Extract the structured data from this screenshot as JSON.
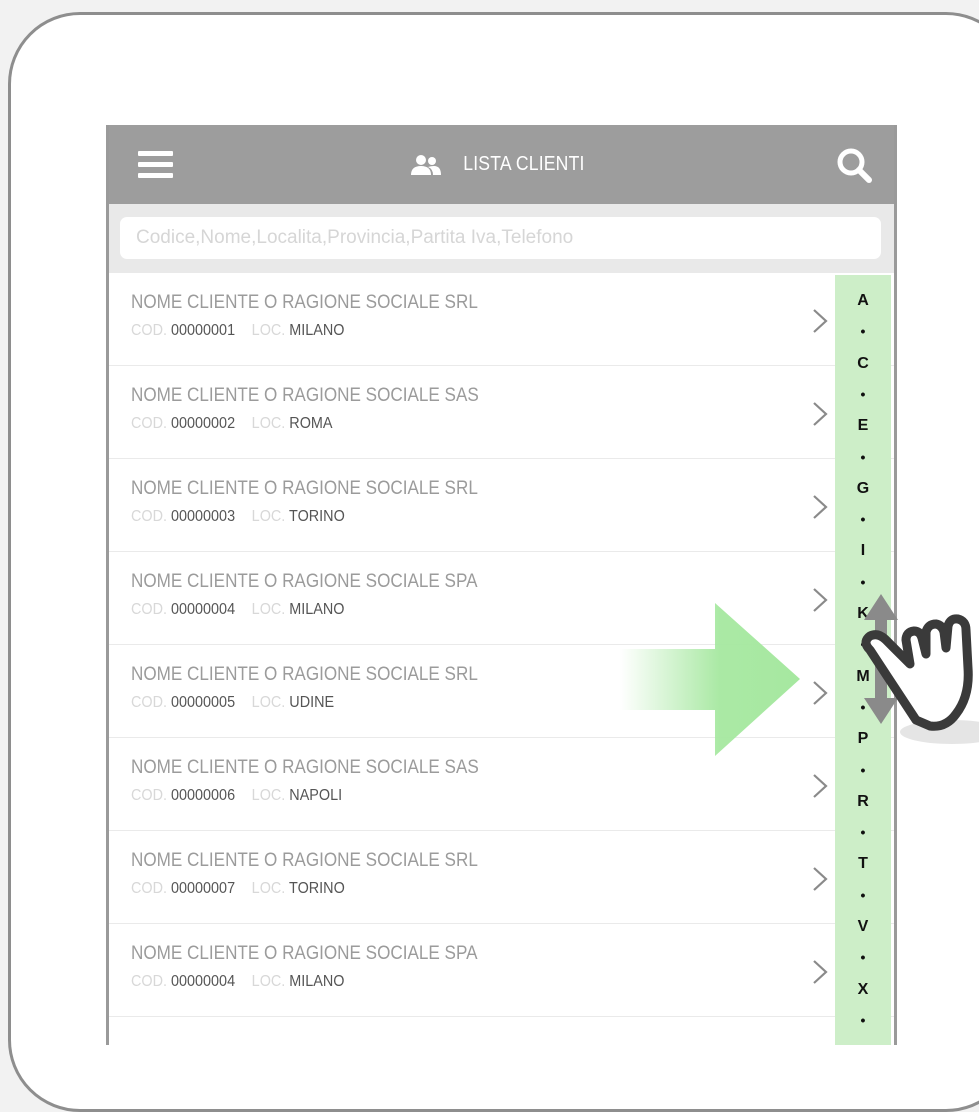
{
  "header": {
    "title": "LISTA CLIENTI",
    "menu_icon": "hamburger-menu-icon",
    "users_icon": "users-icon",
    "search_icon": "search-icon"
  },
  "search": {
    "placeholder": "Codice,Nome,Localita,Provincia,Partita Iva,Telefono"
  },
  "labels": {
    "cod": "COD.",
    "loc": "LOC."
  },
  "clients": [
    {
      "name": "NOME CLIENTE O RAGIONE SOCIALE SRL",
      "code": "00000001",
      "loc": "MILANO"
    },
    {
      "name": "NOME CLIENTE O RAGIONE SOCIALE SAS",
      "code": "00000002",
      "loc": "ROMA"
    },
    {
      "name": "NOME CLIENTE O RAGIONE SOCIALE SRL",
      "code": "00000003",
      "loc": "TORINO"
    },
    {
      "name": "NOME CLIENTE O RAGIONE SOCIALE SPA",
      "code": "00000004",
      "loc": "MILANO"
    },
    {
      "name": "NOME CLIENTE O RAGIONE SOCIALE SRL",
      "code": "00000005",
      "loc": "UDINE"
    },
    {
      "name": "NOME CLIENTE O RAGIONE SOCIALE SAS",
      "code": "00000006",
      "loc": "NAPOLI"
    },
    {
      "name": "NOME CLIENTE O RAGIONE SOCIALE SRL",
      "code": "00000007",
      "loc": "TORINO"
    },
    {
      "name": "NOME CLIENTE O RAGIONE SOCIALE SPA",
      "code": "00000004",
      "loc": "MILANO"
    }
  ],
  "alphabet_index": [
    "A",
    "•",
    "C",
    "•",
    "E",
    "•",
    "G",
    "•",
    "I",
    "•",
    "K",
    "•",
    "M",
    "•",
    "P",
    "•",
    "R",
    "•",
    "T",
    "•",
    "V",
    "•",
    "X",
    "•"
  ],
  "colors": {
    "header_bg": "#9d9d9d",
    "search_bar_bg": "#e9e9e9",
    "index_bg": "#cdeec8",
    "arrow_green": "#a6e8a0",
    "frame": "#8e8e8e"
  }
}
